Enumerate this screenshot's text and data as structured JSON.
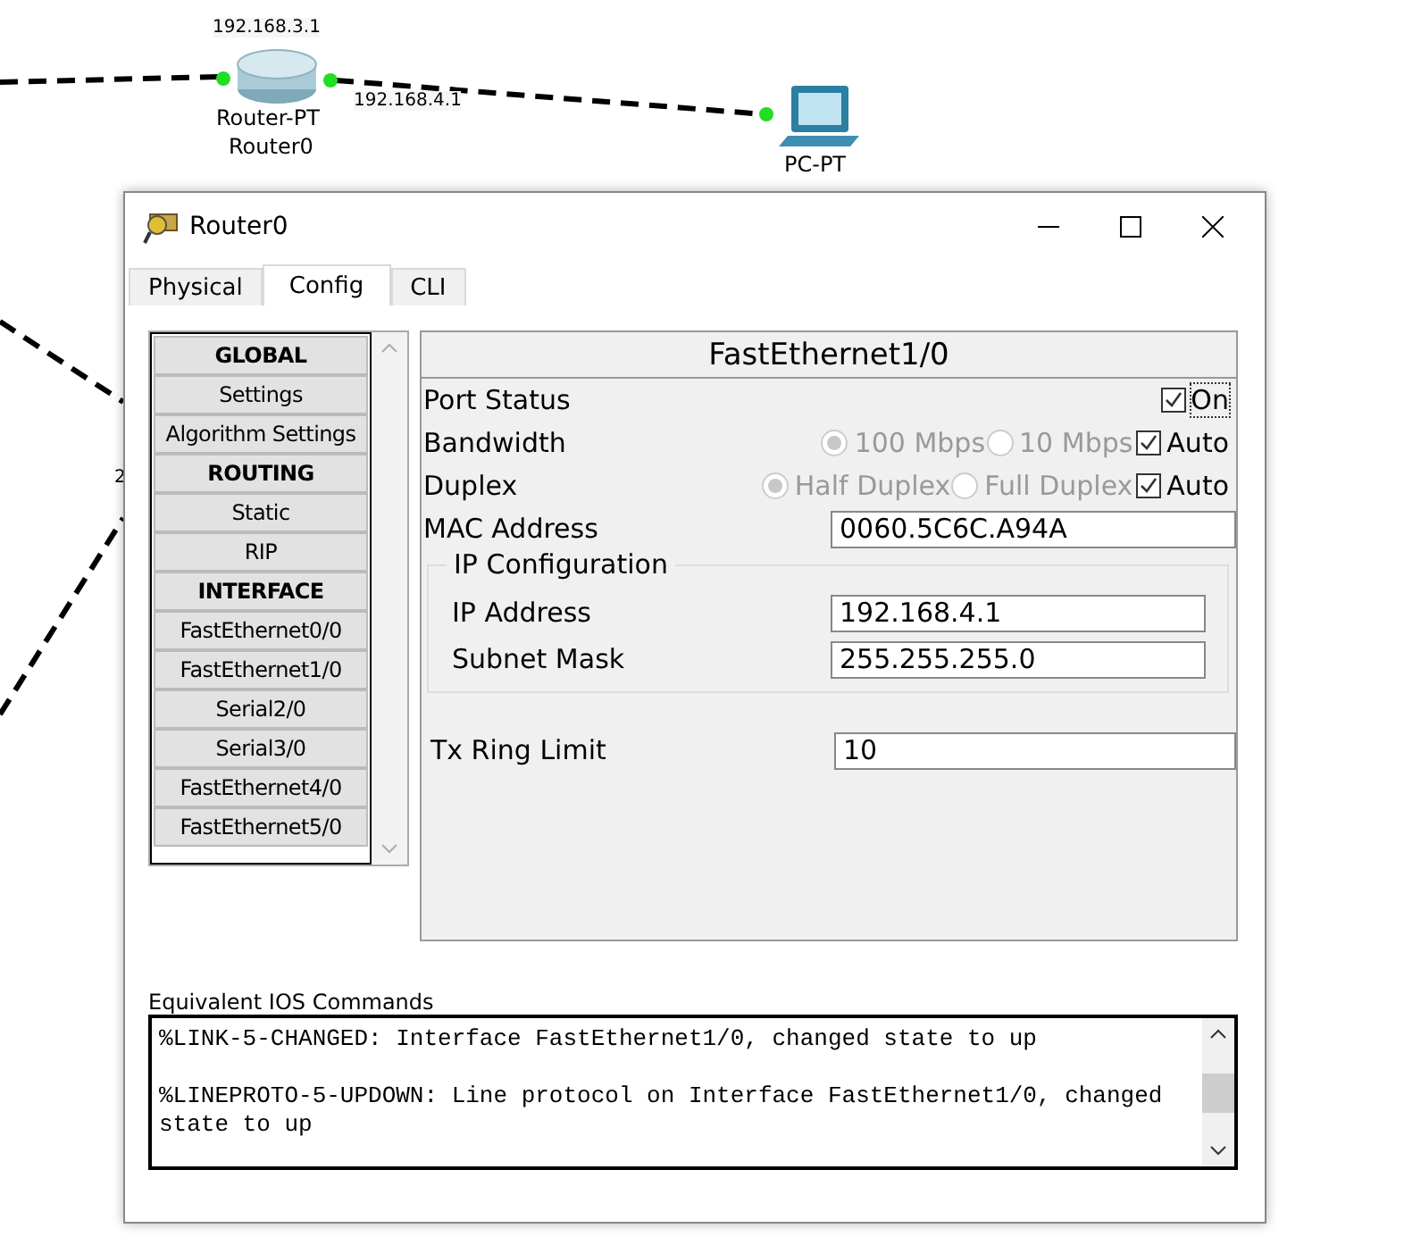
{
  "topology": {
    "link_labels": [
      "192.168.3.1",
      "192.168.4.1"
    ],
    "router": {
      "model": "Router-PT",
      "name": "Router0"
    },
    "pc": {
      "model": "PC-PT"
    },
    "edge_label": "2"
  },
  "window": {
    "title": "Router0"
  },
  "tabs": [
    {
      "label": "Physical",
      "selected": false
    },
    {
      "label": "Config",
      "selected": true
    },
    {
      "label": "CLI",
      "selected": false
    }
  ],
  "sidebar": {
    "items": [
      {
        "label": "GLOBAL",
        "kind": "heading"
      },
      {
        "label": "Settings",
        "kind": "item"
      },
      {
        "label": "Algorithm Settings",
        "kind": "item"
      },
      {
        "label": "ROUTING",
        "kind": "heading"
      },
      {
        "label": "Static",
        "kind": "item"
      },
      {
        "label": "RIP",
        "kind": "item"
      },
      {
        "label": "INTERFACE",
        "kind": "heading"
      },
      {
        "label": "FastEthernet0/0",
        "kind": "item"
      },
      {
        "label": "FastEthernet1/0",
        "kind": "item"
      },
      {
        "label": "Serial2/0",
        "kind": "item"
      },
      {
        "label": "Serial3/0",
        "kind": "item"
      },
      {
        "label": "FastEthernet4/0",
        "kind": "item"
      },
      {
        "label": "FastEthernet5/0",
        "kind": "item"
      }
    ]
  },
  "panel": {
    "title": "FastEthernet1/0",
    "port_status": {
      "label": "Port Status",
      "checkbox": {
        "label": "On",
        "checked": true
      }
    },
    "choices": [
      {
        "label": "Bandwidth",
        "disabled": true,
        "options": [
          {
            "label": "100 Mbps",
            "selected": true
          },
          {
            "label": "10 Mbps",
            "selected": false
          }
        ],
        "auto": {
          "label": "Auto",
          "checked": true
        }
      },
      {
        "label": "Duplex",
        "disabled": true,
        "options": [
          {
            "label": "Half Duplex",
            "selected": true
          },
          {
            "label": "Full Duplex",
            "selected": false
          }
        ],
        "auto": {
          "label": "Auto",
          "checked": true
        }
      }
    ],
    "mac": {
      "label": "MAC Address",
      "value": "0060.5C6C.A94A"
    },
    "ip_configuration": {
      "title": "IP Configuration",
      "fields": [
        {
          "label": "IP Address",
          "value": "192.168.4.1"
        },
        {
          "label": "Subnet Mask",
          "value": "255.255.255.0"
        }
      ]
    },
    "tx_ring": {
      "label": "Tx Ring Limit",
      "value": "10"
    }
  },
  "console": {
    "label": "Equivalent IOS Commands",
    "messages": [
      "%LINK-5-CHANGED: Interface FastEthernet1/0, changed state to up",
      "%LINEPROTO-5-UPDOWN: Line protocol on Interface FastEthernet1/0, changed state to up"
    ]
  }
}
